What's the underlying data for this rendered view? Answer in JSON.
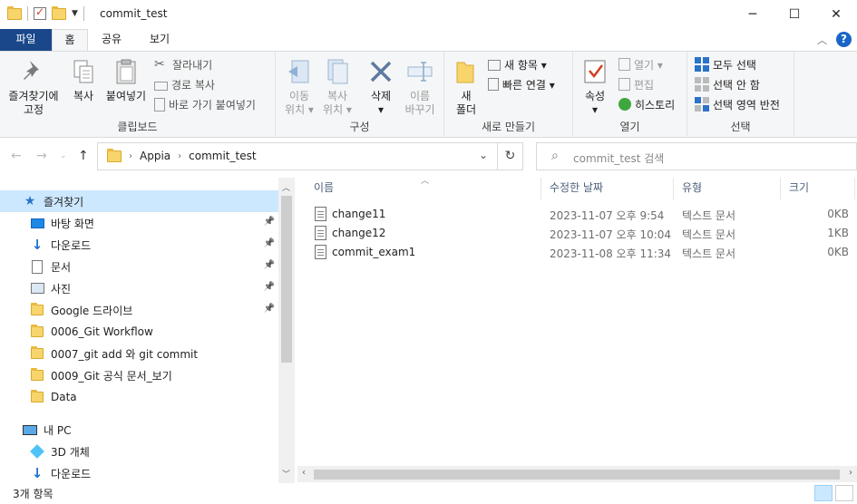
{
  "window": {
    "title": "commit_test",
    "controls": {
      "minimize": "─",
      "maximize": "☐",
      "close": "✕"
    }
  },
  "ribbon_tabs": [
    {
      "label": "파일"
    },
    {
      "label": "홈"
    },
    {
      "label": "공유"
    },
    {
      "label": "보기"
    }
  ],
  "ribbon": {
    "clipboard": {
      "label": "클립보드",
      "pin": "즐겨찾기에\n고정",
      "copy": "복사",
      "paste": "붙여넣기",
      "cut": "잘라내기",
      "copy_path": "경로 복사",
      "paste_shortcut": "바로 가기 붙여넣기"
    },
    "organize": {
      "label": "구성",
      "move_to": "이동\n위치 ▾",
      "copy_to": "복사\n위치 ▾",
      "delete": "삭제\n▾",
      "rename": "이름\n바꾸기"
    },
    "new": {
      "label": "새로 만들기",
      "new_folder": "새\n폴더",
      "new_item": "새 항목 ▾",
      "easy_access": "빠른 연결 ▾"
    },
    "open": {
      "label": "열기",
      "properties": "속성\n▾",
      "open": "열기 ▾",
      "edit": "편집",
      "history": "히스토리"
    },
    "select": {
      "label": "선택",
      "select_all": "모두 선택",
      "select_none": "선택 안 함",
      "invert": "선택 영역 반전"
    }
  },
  "address": {
    "crumbs": [
      "Appia",
      "commit_test"
    ],
    "search_placeholder": "commit_test 검색"
  },
  "nav": {
    "items": [
      {
        "label": "즐겨찾기",
        "icon": "star-icon",
        "indent": 0,
        "selected": true,
        "pinned": false
      },
      {
        "label": "바탕 화면",
        "icon": "desktop-icon",
        "indent": 1,
        "pinned": true
      },
      {
        "label": "다운로드",
        "icon": "download-icon",
        "indent": 1,
        "pinned": true
      },
      {
        "label": "문서",
        "icon": "document-icon",
        "indent": 1,
        "pinned": true
      },
      {
        "label": "사진",
        "icon": "pictures-icon",
        "indent": 1,
        "pinned": true
      },
      {
        "label": "Google 드라이브",
        "icon": "folder-icon",
        "indent": 1,
        "pinned": true
      },
      {
        "label": "0006_Git Workflow",
        "icon": "folder-icon",
        "indent": 1,
        "pinned": false
      },
      {
        "label": "0007_git add 와 git commit",
        "icon": "folder-icon",
        "indent": 1,
        "pinned": false
      },
      {
        "label": "0009_Git 공식 문서_보기",
        "icon": "folder-icon",
        "indent": 1,
        "pinned": false
      },
      {
        "label": "Data",
        "icon": "folder-icon",
        "indent": 1,
        "pinned": false
      },
      {
        "label": "내 PC",
        "icon": "pc-icon",
        "indent": 0,
        "pinned": false,
        "gap": true
      },
      {
        "label": "3D 개체",
        "icon": "cube-icon",
        "indent": 1,
        "pinned": false
      },
      {
        "label": "다운로드",
        "icon": "download-icon",
        "indent": 1,
        "pinned": false
      }
    ]
  },
  "files": {
    "columns": {
      "name": "이름",
      "modified": "수정한 날짜",
      "type": "유형",
      "size": "크기"
    },
    "rows": [
      {
        "name": "change11",
        "modified": "2023-11-07 오후 9:54",
        "type": "텍스트 문서",
        "size": "0KB"
      },
      {
        "name": "change12",
        "modified": "2023-11-07 오후 10:04",
        "type": "텍스트 문서",
        "size": "1KB"
      },
      {
        "name": "commit_exam1",
        "modified": "2023-11-08 오후 11:34",
        "type": "텍스트 문서",
        "size": "0KB"
      }
    ]
  },
  "status": {
    "count": "3개 항목"
  },
  "colors": {
    "file_tab": "#19478a",
    "selected": "#cce8ff",
    "accent": "#1a65c7"
  }
}
